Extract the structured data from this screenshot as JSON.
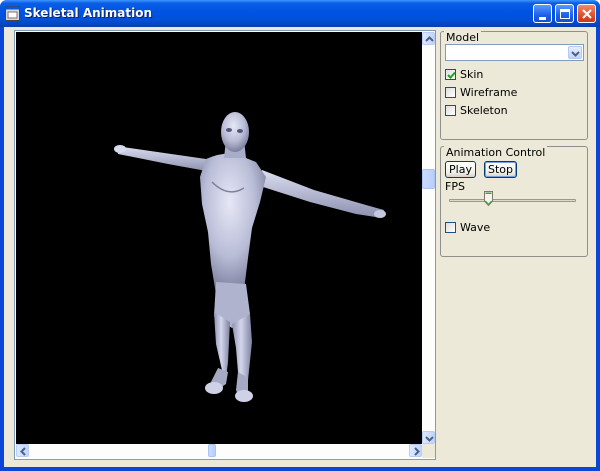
{
  "window": {
    "title": "Skeletal Animation",
    "controls": [
      "minimize",
      "maximize",
      "close"
    ]
  },
  "viewport": {
    "background": "#000000",
    "model_color": "#c2c5dc"
  },
  "model_group": {
    "title": "Model",
    "dropdown_value": "",
    "options": [
      {
        "label": "Skin",
        "checked": true
      },
      {
        "label": "Wireframe",
        "checked": false
      },
      {
        "label": "Skeleton",
        "checked": false
      }
    ]
  },
  "animation_group": {
    "title": "Animation Control",
    "play_label": "Play",
    "stop_label": "Stop",
    "fps_label": "FPS",
    "fps_slider_fraction": 0.3,
    "wave": {
      "label": "Wave",
      "checked": false
    }
  },
  "scrollbars": {
    "vertical_thumb_fraction": 0.34,
    "horizontal_thumb_fraction": 0.48
  },
  "colors": {
    "title_bar": "#0054e3",
    "window_bg": "#ece9d8",
    "check_green": "#21a121",
    "slider_green": "#3aa53a"
  }
}
